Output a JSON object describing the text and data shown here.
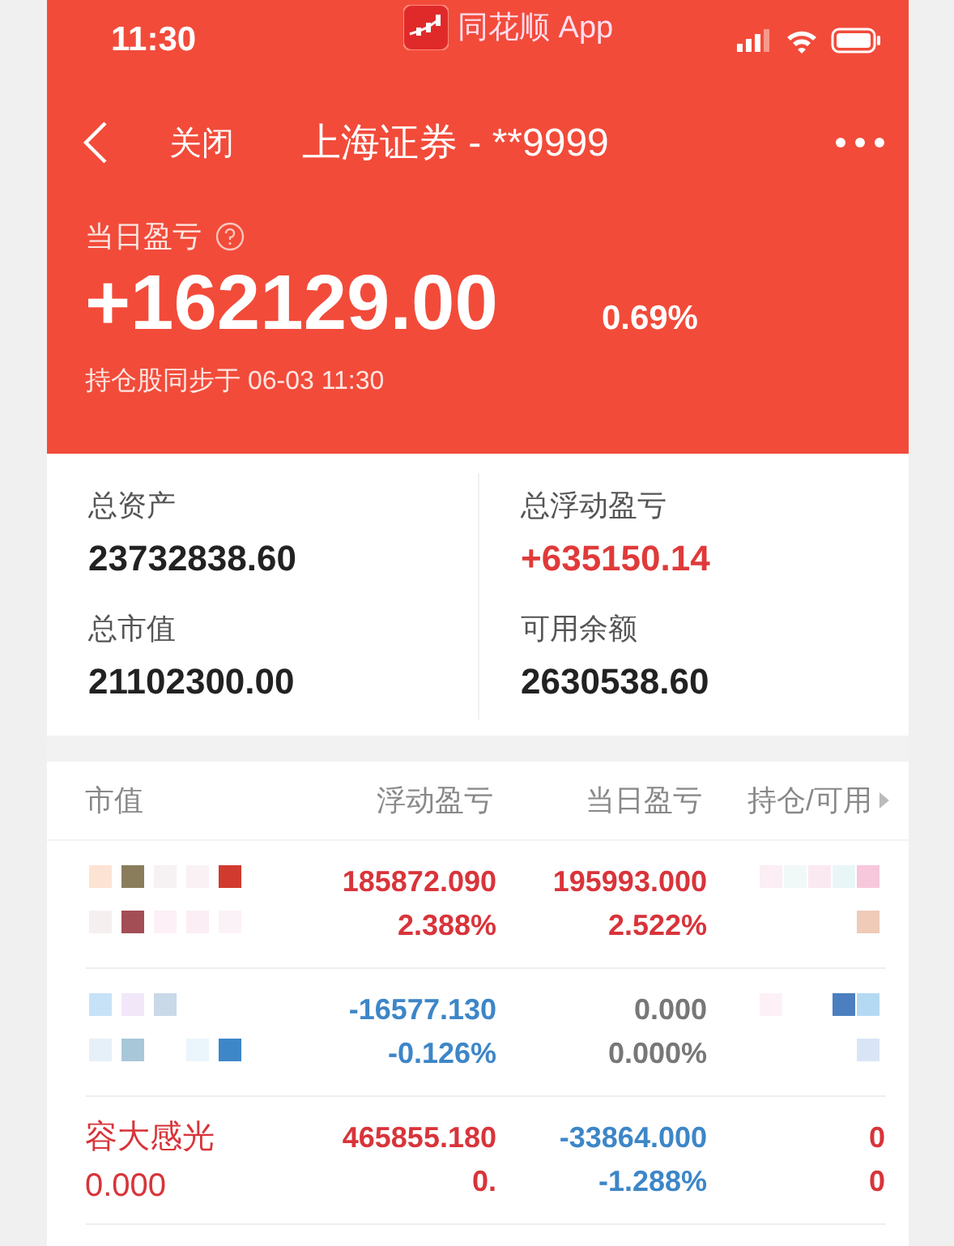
{
  "status_bar": {
    "time": "11:30",
    "app_label": "同花顺 App"
  },
  "nav": {
    "back_label": "关闭",
    "title": "上海证券 - **9999"
  },
  "daily_pnl": {
    "label": "当日盈亏",
    "value": "+162129.00",
    "percent": "0.69%",
    "sync_note": "持仓股同步于 06-03 11:30"
  },
  "summary": [
    {
      "label": "总资产",
      "value": "23732838.60",
      "color": "#222222"
    },
    {
      "label": "总浮动盈亏",
      "value": "+635150.14",
      "color": "#e03a3a"
    },
    {
      "label": "总市值",
      "value": "21102300.00",
      "color": "#222222"
    },
    {
      "label": "可用余额",
      "value": "2630538.60",
      "color": "#222222"
    }
  ],
  "table": {
    "columns": [
      "市值",
      "浮动盈亏",
      "当日盈亏",
      "持仓/可用"
    ],
    "rows": [
      {
        "kind": "masked",
        "float_pnl": {
          "value": "185872.090",
          "percent": "2.388%",
          "color": "#d8343a"
        },
        "daily_pnl": {
          "value": "195993.000",
          "percent": "2.522%",
          "color": "#d8343a"
        }
      },
      {
        "kind": "masked",
        "float_pnl": {
          "value": "-16577.130",
          "percent": "-0.126%",
          "color": "#3d86c8"
        },
        "daily_pnl": {
          "value": "0.000",
          "percent": "0.000%",
          "color": "#777777"
        }
      },
      {
        "kind": "named",
        "name": "容大感光",
        "market_value": "0.000",
        "color": "#d8343a",
        "float_pnl": {
          "value": "465855.180",
          "percent": "0.",
          "color": "#d8343a"
        },
        "daily_pnl": {
          "value": "-33864.000",
          "percent": "-1.288%",
          "color": "#3d86c8"
        },
        "holding": "0",
        "available": "0"
      }
    ]
  }
}
